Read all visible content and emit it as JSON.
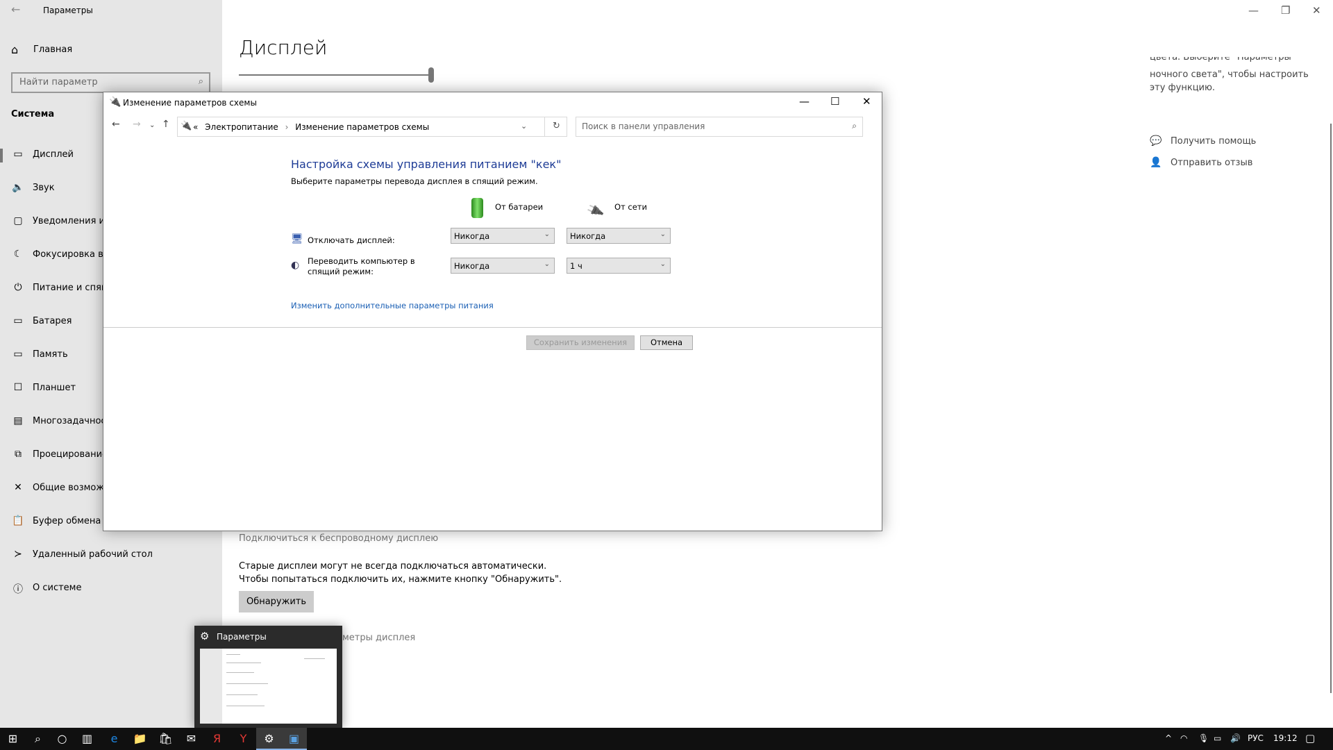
{
  "settings": {
    "title": "Параметры",
    "home": "Главная",
    "search_placeholder": "Найти параметр",
    "section": "Система",
    "items": [
      {
        "label": "Дисплей",
        "icon": "monitor-icon",
        "selected": true
      },
      {
        "label": "Звук",
        "icon": "speaker-icon"
      },
      {
        "label": "Уведомления и",
        "icon": "notification-icon"
      },
      {
        "label": "Фокусировка вн",
        "icon": "moon-icon"
      },
      {
        "label": "Питание и спящ",
        "icon": "power-icon"
      },
      {
        "label": "Батарея",
        "icon": "battery-icon"
      },
      {
        "label": "Память",
        "icon": "storage-icon"
      },
      {
        "label": "Планшет",
        "icon": "tablet-icon"
      },
      {
        "label": "Многозадачнос",
        "icon": "multitasking-icon"
      },
      {
        "label": "Проецирование",
        "icon": "projecting-icon"
      },
      {
        "label": "Общие возмож",
        "icon": "shared-experiences-icon"
      },
      {
        "label": "Буфер обмена",
        "icon": "clipboard-icon"
      },
      {
        "label": "Удаленный рабочий стол",
        "icon": "remote-desktop-icon"
      },
      {
        "label": "О системе",
        "icon": "info-icon"
      }
    ],
    "page_title": "Дисплей",
    "brightness_percent": 100,
    "right_clipped": "цвета. Выберите \"Параметры",
    "right_text": "ночного света\", чтобы настроить эту функцию.",
    "help": "Получить помощь",
    "feedback": "Отправить отзыв",
    "wireless": "Подключиться к беспроводному дисплею",
    "old_displays_1": "Старые дисплеи могут не всегда подключаться автоматически.",
    "old_displays_2": "Чтобы попытаться подключить их, нажмите кнопку \"Обнаружить\".",
    "detect": "Обнаружить",
    "advanced_partial": "метры дисплея"
  },
  "dialog": {
    "title": "Изменение параметров схемы",
    "breadcrumb": [
      "«",
      "Электропитание",
      "›",
      "Изменение параметров схемы"
    ],
    "search_placeholder": "Поиск в панели управления",
    "heading": "Настройка схемы управления питанием \"кек\"",
    "subheading": "Выберите параметры перевода дисплея в спящий режим.",
    "col_battery": "От батареи",
    "col_ac": "От сети",
    "rows": [
      {
        "label": "Отключать дисплей:",
        "battery": "Никогда",
        "ac": "Никогда"
      },
      {
        "label": "Переводить компьютер в спящий режим:",
        "battery": "Никогда",
        "ac": "1 ч"
      }
    ],
    "advanced_link": "Изменить дополнительные параметры питания",
    "save": "Сохранить изменения",
    "cancel": "Отмена"
  },
  "preview": {
    "title": "Параметры"
  },
  "taskbar": {
    "apps": [
      "start-icon",
      "search-icon",
      "cortana-icon",
      "task-view-icon",
      "edge-icon",
      "file-explorer-icon",
      "store-icon",
      "mail-icon",
      "yandex-icon",
      "yandex-browser-icon",
      "settings-icon",
      "control-panel-icon"
    ],
    "lang": "РУС",
    "time": "19:12"
  }
}
